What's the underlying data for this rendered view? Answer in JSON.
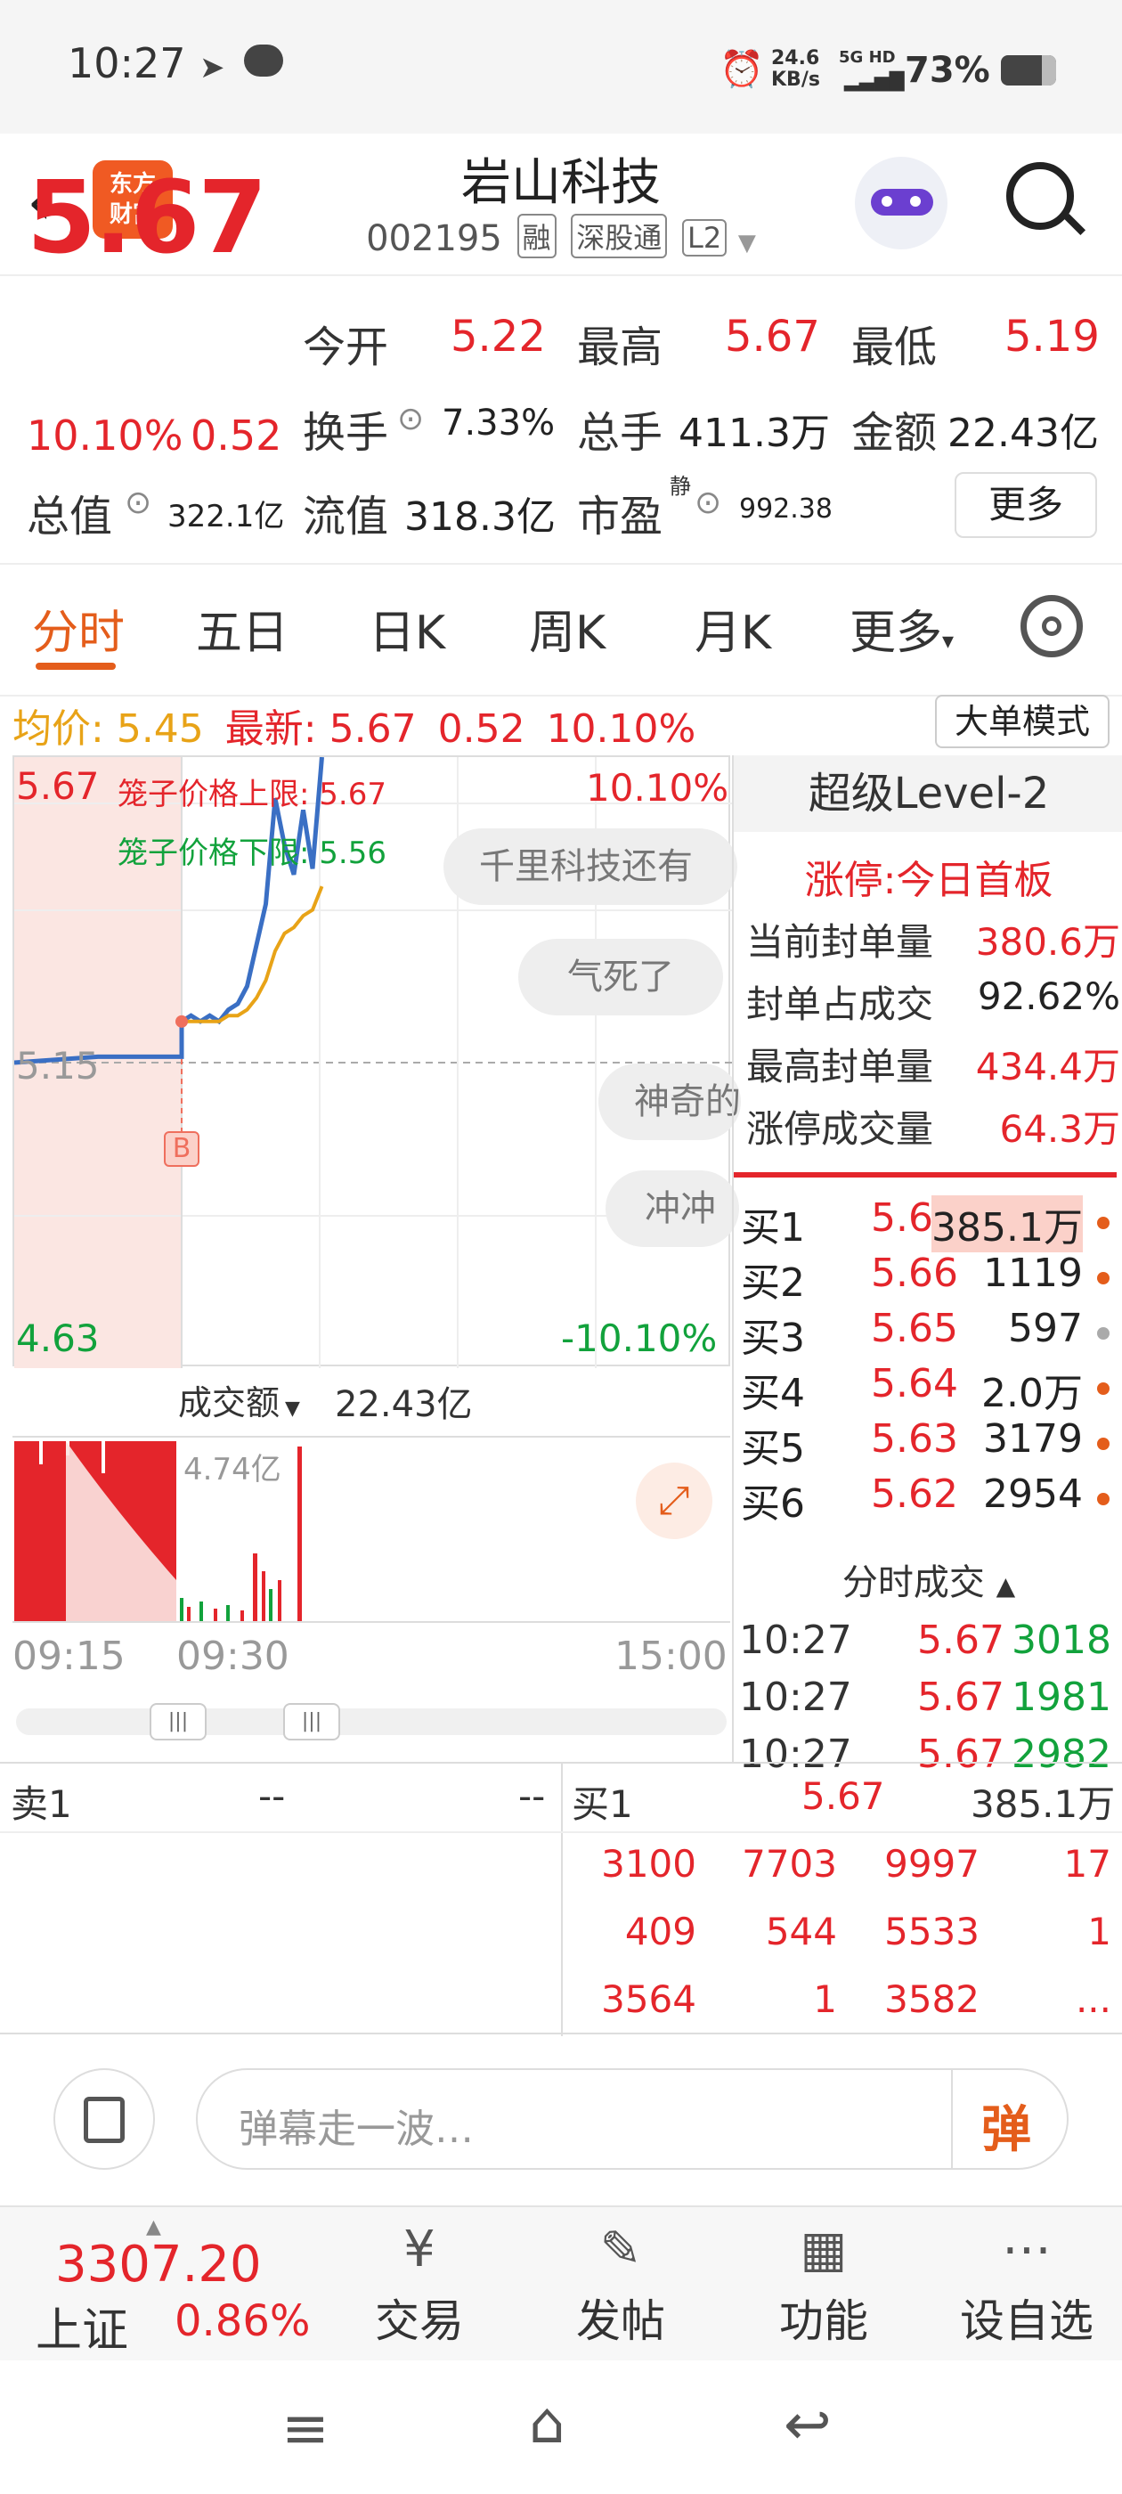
{
  "status_bar": {
    "time": "10:27",
    "net_speed_top": "24.6",
    "net_speed_bottom": "KB/s",
    "signal": "5G HD",
    "battery": "73%"
  },
  "header": {
    "logo_line1": "东方",
    "logo_line2": "财富",
    "title": "岩山科技",
    "code": "002195",
    "tags": [
      "融",
      "深股通",
      "L2"
    ]
  },
  "quote": {
    "price": "5.67",
    "change_pct": "10.10%",
    "change": "0.52",
    "open_label": "今开",
    "open": "5.22",
    "high_label": "最高",
    "high": "5.67",
    "low_label": "最低",
    "low": "5.19",
    "turnover_label": "换手",
    "turnover": "7.33%",
    "volume_label": "总手",
    "volume": "411.3万",
    "amount_label": "金额",
    "amount": "22.43亿",
    "mktcap_label": "总值",
    "mktcap": "322.1亿",
    "float_label": "流值",
    "float": "318.3亿",
    "pe_label": "市盈",
    "pe_sup": "静",
    "pe": "992.38",
    "more": "更多"
  },
  "tabs": [
    "分时",
    "五日",
    "日K",
    "周K",
    "月K",
    "更多"
  ],
  "info_bar": {
    "avg_label": "均价:",
    "avg": "5.45",
    "latest_label": "最新:",
    "latest": "5.67",
    "latest_chg": "0.52",
    "latest_pct": "10.10%",
    "mode_button": "大单模式"
  },
  "chart": {
    "top_price": "5.67",
    "limit_up_label": "笼子价格上限:",
    "limit_up": "5.67",
    "limit_down_label": "笼子价格下限:",
    "limit_down": "5.56",
    "top_pct": "10.10%",
    "mid_price": "5.15",
    "bottom_price": "4.63",
    "bottom_pct": "-10.10%",
    "marker": "B",
    "danmaku": [
      "千里科技还有",
      "气死了",
      "神奇的",
      "冲冲"
    ],
    "volume_label": "成交额",
    "volume_total": "22.43亿",
    "volume_max": "4.74亿",
    "time_labels": [
      "09:15",
      "09:30",
      "15:00"
    ],
    "colors": {
      "price": "#3a6fc4",
      "avg": "#e8a317",
      "up": "#e4252b",
      "down": "#12a23c"
    }
  },
  "chart_data": {
    "type": "line",
    "x": [
      "09:15",
      "09:20",
      "09:25",
      "09:30",
      "09:31",
      "09:32",
      "09:33",
      "09:34",
      "09:35",
      "09:36",
      "09:37",
      "09:38",
      "09:39",
      "09:40",
      "09:41",
      "09:42",
      "09:43",
      "09:44",
      "09:45"
    ],
    "series": [
      {
        "values": [
          5.15,
          5.16,
          5.16,
          5.22,
          5.23,
          5.22,
          5.23,
          5.22,
          5.24,
          5.25,
          5.28,
          5.35,
          5.42,
          5.6,
          5.52,
          5.47,
          5.58,
          5.48,
          5.67
        ]
      },
      {
        "values": [
          null,
          null,
          null,
          5.22,
          5.22,
          5.22,
          5.22,
          5.22,
          5.23,
          5.23,
          5.24,
          5.26,
          5.29,
          5.34,
          5.37,
          5.38,
          5.4,
          5.41,
          5.45
        ]
      }
    ],
    "ylim": [
      4.63,
      5.67
    ]
  },
  "level2": {
    "title": "超级Level-2",
    "limit_status": "涨停:今日首板",
    "rows": [
      {
        "label": "当前封单量",
        "value": "380.6万"
      },
      {
        "label": "封单占成交",
        "value": "92.62%"
      },
      {
        "label": "最高封单量",
        "value": "434.4万"
      },
      {
        "label": "涨停成交量",
        "value": "64.3万"
      }
    ],
    "bids": [
      {
        "label": "买1",
        "price": "5.67",
        "vol": "385.1万"
      },
      {
        "label": "买2",
        "price": "5.66",
        "vol": "1119"
      },
      {
        "label": "买3",
        "price": "5.65",
        "vol": "597"
      },
      {
        "label": "买4",
        "price": "5.64",
        "vol": "2.0万"
      },
      {
        "label": "买5",
        "price": "5.63",
        "vol": "3179"
      },
      {
        "label": "买6",
        "price": "5.62",
        "vol": "2954"
      }
    ],
    "ticks_title": "分时成交",
    "ticks": [
      {
        "time": "10:27",
        "price": "5.67",
        "vol": "3018"
      },
      {
        "time": "10:27",
        "price": "5.67",
        "vol": "1981"
      },
      {
        "time": "10:27",
        "price": "5.67",
        "vol": "2982"
      }
    ]
  },
  "orderbook": {
    "ask_label": "卖1",
    "ask_price": "--",
    "ask_vol": "--",
    "bid_label": "买1",
    "bid_price": "5.67",
    "bid_vol": "385.1万",
    "queue": [
      [
        "3100",
        "7703",
        "9997",
        "17"
      ],
      [
        "409",
        "544",
        "5533",
        "1"
      ],
      [
        "3564",
        "1",
        "3582",
        "..."
      ]
    ]
  },
  "comment": {
    "placeholder": "弹幕走一波…",
    "send": "弹"
  },
  "footer": {
    "index_value": "3307.20",
    "index_name": "上证",
    "index_pct": "0.86%",
    "items": [
      "交易",
      "发帖",
      "功能",
      "设自选"
    ]
  }
}
